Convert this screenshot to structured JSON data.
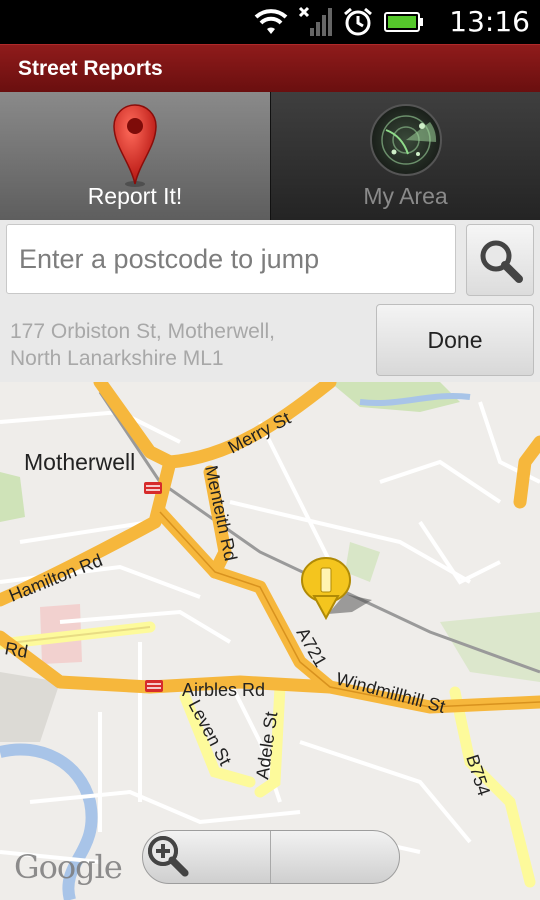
{
  "status_bar": {
    "time": "13:16",
    "icons": [
      "wifi-icon",
      "no-signal-icon",
      "alarm-icon",
      "battery-icon"
    ]
  },
  "app": {
    "title": "Street Reports"
  },
  "tabs": [
    {
      "label": "Report It!",
      "icon": "location-pin-icon",
      "active": true
    },
    {
      "label": "My Area",
      "icon": "radar-icon",
      "active": false
    }
  ],
  "search": {
    "placeholder": "Enter a postcode to jump",
    "value": ""
  },
  "location": {
    "address_line1": "177 Orbiston St, Motherwell,",
    "address_line2": "North Lanarkshire ML1",
    "done_label": "Done"
  },
  "map": {
    "place_labels": [
      "Motherwell"
    ],
    "road_labels": [
      "Merry St",
      "Menteith Rd",
      "Hamilton Rd",
      "A721",
      "Airbles Rd",
      "Windmillhill St",
      "Leven St",
      "Adele St",
      "B754",
      "Rd"
    ],
    "attribution": "Google",
    "colors": {
      "main_road": "#f6b73c",
      "minor_road": "#fdfa9b",
      "water": "#a8c4e8",
      "park": "#cfe3b8"
    }
  },
  "colors": {
    "title_bar": "#7d1515",
    "tab_active": "#767676",
    "tab_inactive": "#303030"
  }
}
